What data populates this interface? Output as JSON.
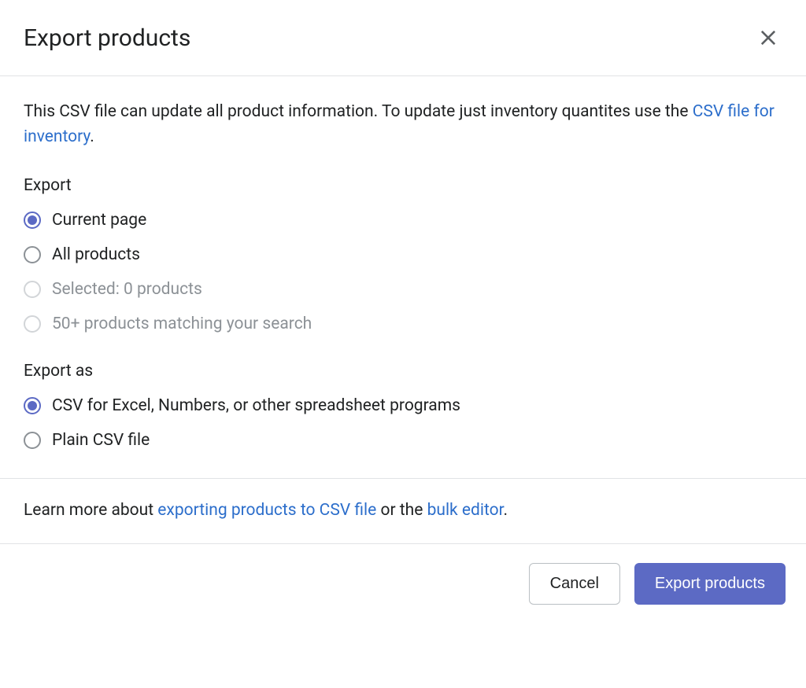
{
  "header": {
    "title": "Export products"
  },
  "description": {
    "text_before_link": "This CSV file can update all product information. To update just inventory quantites use the ",
    "link_text": "CSV file for inventory",
    "text_after_link": "."
  },
  "export_section": {
    "label": "Export",
    "options": [
      {
        "label": "Current page",
        "selected": true,
        "disabled": false
      },
      {
        "label": "All products",
        "selected": false,
        "disabled": false
      },
      {
        "label": "Selected: 0 products",
        "selected": false,
        "disabled": true
      },
      {
        "label": "50+ products matching your search",
        "selected": false,
        "disabled": true
      }
    ]
  },
  "export_as_section": {
    "label": "Export as",
    "options": [
      {
        "label": "CSV for Excel, Numbers, or other spreadsheet programs",
        "selected": true,
        "disabled": false
      },
      {
        "label": "Plain CSV file",
        "selected": false,
        "disabled": false
      }
    ]
  },
  "learn_more": {
    "text_before": "Learn more about ",
    "link1": "exporting products to CSV file",
    "text_middle": " or the ",
    "link2": "bulk editor",
    "text_after": "."
  },
  "footer": {
    "cancel_label": "Cancel",
    "export_label": "Export products"
  }
}
